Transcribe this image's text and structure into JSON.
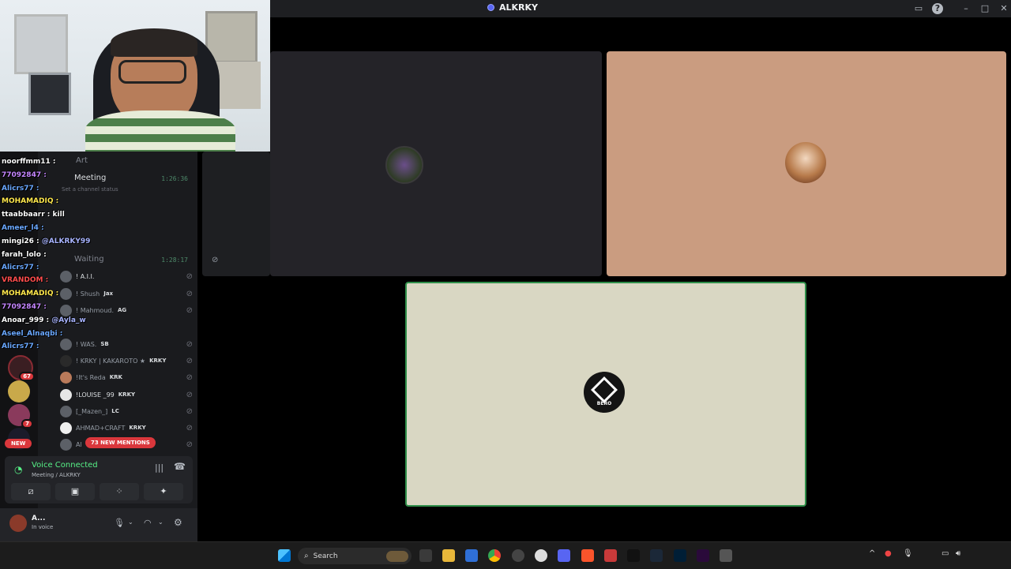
{
  "window": {
    "title": "ALKRKY",
    "controls": [
      "screen-share-icon",
      "help-icon",
      "minimize",
      "maximize",
      "close"
    ]
  },
  "channels": {
    "art_label": "Art",
    "meeting": {
      "name": "Meeting",
      "timer": "1:26:36",
      "status_placeholder": "Set a channel status"
    },
    "waiting": {
      "name": "Waiting",
      "timer": "1:28:17"
    }
  },
  "members": [
    {
      "name": "! A.I.I.",
      "tag": ""
    },
    {
      "name": "! Shush",
      "tag": "Jax"
    },
    {
      "name": "! Mahmoud.",
      "tag": "AG"
    },
    {
      "name": "! WAS.",
      "tag": "SB"
    },
    {
      "name": "! KRKY | KAKAROTO ★",
      "tag": "KRKY"
    },
    {
      "name": "!It's Reda",
      "tag": "KRK"
    },
    {
      "name": "!LOUISE _99",
      "tag": "KRKY"
    },
    {
      "name": "[_Mazen_]",
      "tag": "LC"
    },
    {
      "name": "AHMAD+CRAFT",
      "tag": "KRKY"
    },
    {
      "name": "Al",
      "tag": ""
    }
  ],
  "chat_overlay": [
    {
      "user": "noorffmm11 :",
      "msg": "",
      "color": "#ffffff"
    },
    {
      "user": "77092847 :",
      "msg": "",
      "color": "#c586ff"
    },
    {
      "user": "Alicrs77 :",
      "msg": "",
      "color": "#6aa8ff"
    },
    {
      "user": "MOHAMADIQ :",
      "msg": "",
      "color": "#ffe84d"
    },
    {
      "user": "ttaabbaarr :",
      "msg": "kill",
      "color": "#ffffff"
    },
    {
      "user": "Ameer_l4 :",
      "msg": "",
      "color": "#6aa8ff"
    },
    {
      "user": "mingi26 :",
      "msg": "@ALKRKY99",
      "color": "#ffffff"
    },
    {
      "user": "farah_lolo :",
      "msg": "",
      "color": "#ffffff"
    },
    {
      "user": "Alicrs77 :",
      "msg": "",
      "color": "#6aa8ff"
    },
    {
      "user": "VRANDOM :",
      "msg": "",
      "color": "#ff4d4d"
    },
    {
      "user": "MOHAMADIQ :",
      "msg": "",
      "color": "#ffe84d"
    },
    {
      "user": "77092847 :",
      "msg": "",
      "color": "#c586ff"
    },
    {
      "user": "Anoar_999 :",
      "msg": "@Ayla_w",
      "color": "#ffffff"
    },
    {
      "user": "Aseel_Alnaqbi :",
      "msg": "",
      "color": "#6aa8ff"
    },
    {
      "user": "Alicrs77 :",
      "msg": "",
      "color": "#6aa8ff"
    }
  ],
  "guild_badges": [
    "67",
    "7"
  ],
  "new_label": "NEW",
  "mentions_label": "73 NEW MENTIONS",
  "voice": {
    "status": "Voice Connected",
    "location": "Meeting / ALKRKY"
  },
  "user": {
    "name": "A...",
    "status": "In voice"
  },
  "tiles": {
    "bero_label": "BERO"
  },
  "taskbar": {
    "search_placeholder": "Search"
  },
  "colors": {
    "accent": "#5865f2",
    "voice_green": "#57f287",
    "mention_red": "#da373c",
    "tile2_bg": "#ca9c80",
    "tile3_bg": "#d9d7c3"
  }
}
